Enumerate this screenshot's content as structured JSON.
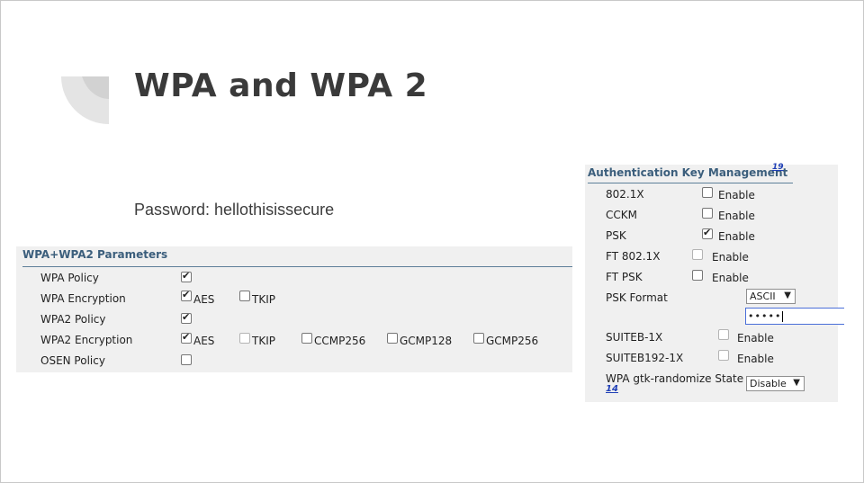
{
  "slide": {
    "title": "WPA and WPA 2",
    "password_text": "Password: hellothisissecure"
  },
  "wpa_params": {
    "header": "WPA+WPA2 Parameters",
    "rows": [
      {
        "label": "WPA Policy"
      },
      {
        "label": "WPA Encryption"
      },
      {
        "label": "WPA2 Policy"
      },
      {
        "label": "WPA2 Encryption"
      },
      {
        "label": "OSEN Policy"
      }
    ],
    "options": {
      "aes": "AES",
      "tkip": "TKIP",
      "ccmp256": "CCMP256",
      "gcmp128": "GCMP128",
      "gcmp256": "GCMP256"
    },
    "state": {
      "wpa_policy": true,
      "wpa_aes": true,
      "wpa_tkip": false,
      "wpa2_policy": true,
      "wpa2_aes": true,
      "wpa2_tkip": false,
      "wpa2_ccmp256": false,
      "wpa2_gcmp128": false,
      "wpa2_gcmp256": false,
      "osen_policy": false
    }
  },
  "akm": {
    "header": "Authentication Key Management",
    "footnote": "19",
    "enable_label": "Enable",
    "rows": [
      {
        "label": "802.1X",
        "checked": false
      },
      {
        "label": "CCKM",
        "checked": false
      },
      {
        "label": "PSK",
        "checked": true
      },
      {
        "label": "FT 802.1X",
        "checked": false
      },
      {
        "label": "FT PSK",
        "checked": false
      }
    ],
    "psk_format": {
      "label": "PSK Format",
      "selected": "ASCII"
    },
    "psk_value_masked": "•••••",
    "suiteb_rows": [
      {
        "label": "SUITEB-1X",
        "checked": false
      },
      {
        "label": "SUITEB192-1X",
        "checked": false
      }
    ],
    "gtk": {
      "label": "WPA gtk-randomize State",
      "footnote": "14",
      "selected": "Disable"
    }
  },
  "colors": {
    "header_text": "#3b5e7c",
    "panel_bg": "#f0f0f0",
    "link": "#1f3fb6",
    "title": "#3a3a3a"
  }
}
